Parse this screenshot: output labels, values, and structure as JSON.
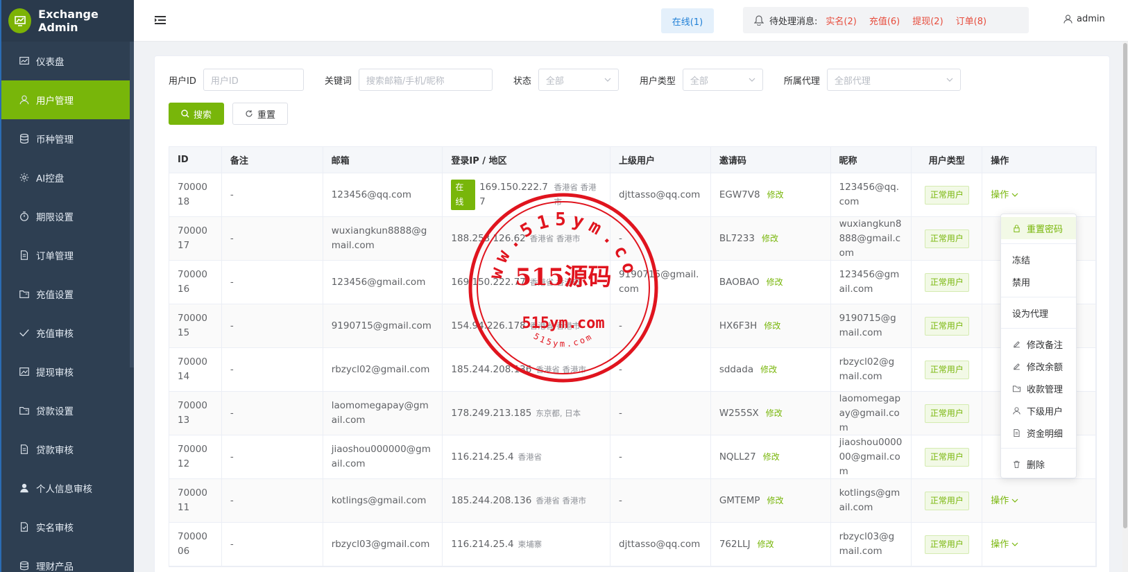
{
  "brand": {
    "title": "Exchange Admin"
  },
  "sidebar": {
    "items": [
      {
        "label": "仪表盘",
        "icon": "dashboard-icon",
        "active": false
      },
      {
        "label": "用户管理",
        "icon": "user-icon",
        "active": true
      },
      {
        "label": "币种管理",
        "icon": "database-icon",
        "active": false
      },
      {
        "label": "AI控盘",
        "icon": "gear-icon",
        "active": false
      },
      {
        "label": "期限设置",
        "icon": "timer-icon",
        "active": false
      },
      {
        "label": "订单管理",
        "icon": "document-icon",
        "active": false
      },
      {
        "label": "充值设置",
        "icon": "folder-icon",
        "active": false
      },
      {
        "label": "充值审核",
        "icon": "check-icon",
        "active": false
      },
      {
        "label": "提现审核",
        "icon": "picture-icon",
        "active": false
      },
      {
        "label": "贷款设置",
        "icon": "folder-icon",
        "active": false
      },
      {
        "label": "贷款审核",
        "icon": "document-icon",
        "active": false
      },
      {
        "label": "个人信息审核",
        "icon": "user-filled-icon",
        "active": false
      },
      {
        "label": "实名审核",
        "icon": "document-check-icon",
        "active": false
      },
      {
        "label": "理财产品",
        "icon": "coins-icon",
        "active": false
      }
    ]
  },
  "header": {
    "online": "在线(1)",
    "pending_label": "待处理消息:",
    "alerts": [
      "实名(2)",
      "充值(6)",
      "提现(2)",
      "订单(8)"
    ],
    "user": "admin"
  },
  "filters": {
    "user_id_label": "用户ID",
    "user_id_placeholder": "用户ID",
    "keyword_label": "关键词",
    "keyword_placeholder": "搜索邮箱/手机/昵称",
    "status_label": "状态",
    "status_value": "全部",
    "type_label": "用户类型",
    "type_value": "全部",
    "agent_label": "所属代理",
    "agent_value": "全部代理",
    "search_btn": "搜索",
    "reset_btn": "重置"
  },
  "table": {
    "columns": [
      "ID",
      "备注",
      "邮箱",
      "登录IP / 地区",
      "上级用户",
      "邀请码",
      "昵称",
      "用户类型",
      "操作"
    ],
    "edit_label": "修改",
    "op_label": "操作",
    "online_tag": "在线",
    "rows": [
      {
        "id": "7000018",
        "note": "-",
        "email": "123456@qq.com",
        "online": true,
        "ip": "169.150.222.77",
        "region": "香港省 香港市",
        "parent": "djttasso@qq.com",
        "invite": "EGW7V8",
        "nick": "123456@qq.com",
        "type": "正常用户"
      },
      {
        "id": "7000017",
        "note": "-",
        "email": "wuxiangkun8888@gmail.com",
        "online": false,
        "ip": "188.253.126.62",
        "region": "香港省 香港市",
        "parent": "-",
        "invite": "BL7233",
        "nick": "wuxiangkun8888@gmail.com",
        "type": "正常用户"
      },
      {
        "id": "7000016",
        "note": "-",
        "email": "123456@gmail.com",
        "online": false,
        "ip": "169.150.222.77",
        "region": "香港省 香港市",
        "parent": "9190715@gmail.com",
        "invite": "BAOBAO",
        "nick": "123456@gmail.com",
        "type": "正常用户"
      },
      {
        "id": "7000015",
        "note": "-",
        "email": "9190715@gmail.com",
        "online": false,
        "ip": "154.94.226.178",
        "region": "香港省 香港市",
        "parent": "-",
        "invite": "HX6F3H",
        "nick": "9190715@gmail.com",
        "type": "正常用户"
      },
      {
        "id": "7000014",
        "note": "-",
        "email": "rbzycl02@gmail.com",
        "online": false,
        "ip": "185.244.208.136",
        "region": "香港省 香港市",
        "parent": "-",
        "invite": "sddada",
        "nick": "rbzycl02@gmail.com",
        "type": "正常用户"
      },
      {
        "id": "7000013",
        "note": "-",
        "email": "laomomegapay@gmail.com",
        "online": false,
        "ip": "178.249.213.185",
        "region": "东京都, 日本",
        "parent": "-",
        "invite": "W255SX",
        "nick": "laomomegapay@gmail.com",
        "type": "正常用户"
      },
      {
        "id": "7000012",
        "note": "-",
        "email": "jiaoshou000000@gmail.com",
        "online": false,
        "ip": "116.214.25.4",
        "region": "香港省",
        "parent": "-",
        "invite": "NQLL27",
        "nick": "jiaoshou000000@gmail.com",
        "type": "正常用户"
      },
      {
        "id": "7000011",
        "note": "-",
        "email": "kotlings@gmail.com",
        "online": false,
        "ip": "185.244.208.136",
        "region": "香港省 香港市",
        "parent": "-",
        "invite": "GMTEMP",
        "nick": "kotlings@gmail.com",
        "type": "正常用户"
      },
      {
        "id": "7000006",
        "note": "-",
        "email": "rbzycl03@gmail.com",
        "online": false,
        "ip": "116.214.25.4",
        "region": "柬埔寨",
        "parent": "djttasso@qq.com",
        "invite": "762LLJ",
        "nick": "rbzycl03@gmail.com",
        "type": "正常用户"
      }
    ]
  },
  "dropdown": {
    "items": [
      {
        "label": "重置密码",
        "icon": "lock-icon",
        "highlight": true,
        "divider_after": true
      },
      {
        "label": "冻结",
        "icon": "",
        "highlight": false,
        "divider_after": false
      },
      {
        "label": "禁用",
        "icon": "",
        "highlight": false,
        "divider_after": true
      },
      {
        "label": "设为代理",
        "icon": "",
        "highlight": false,
        "divider_after": true
      },
      {
        "label": "修改备注",
        "icon": "edit-icon",
        "highlight": false,
        "divider_after": false
      },
      {
        "label": "修改余额",
        "icon": "edit-icon",
        "highlight": false,
        "divider_after": false
      },
      {
        "label": "收款管理",
        "icon": "folder-icon",
        "highlight": false,
        "divider_after": false
      },
      {
        "label": "下级用户",
        "icon": "user-icon",
        "highlight": false,
        "divider_after": false
      },
      {
        "label": "资金明细",
        "icon": "document-icon",
        "highlight": false,
        "divider_after": true
      },
      {
        "label": "删除",
        "icon": "trash-icon",
        "highlight": false,
        "divider_after": false
      }
    ]
  },
  "watermark": {
    "center": "515源码",
    "arc_top": "www.515ym.com",
    "center_bottom": "515ym.com",
    "arc_bottom": "515ym.com"
  }
}
